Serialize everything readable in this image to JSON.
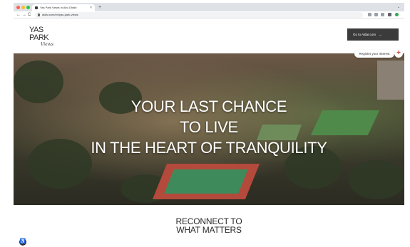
{
  "browser": {
    "tab_title": "Yas Park Views in Abu Dhabi",
    "tab_close": "×",
    "new_tab": "+",
    "tab_menu": "⌄",
    "nav": {
      "back": "←",
      "forward": "→",
      "reload": "C"
    },
    "url": "aldar.com/en/yas-park-views",
    "traffic_lights": [
      "#ff5f57",
      "#febc2e",
      "#28c840"
    ],
    "extension_icons": [
      "share-icon",
      "star-icon",
      "extensions-icon",
      "sidebar-icon",
      "profile-icon"
    ]
  },
  "header": {
    "logo": {
      "line1": "YAS",
      "line2": "PARK",
      "signature": "Views"
    },
    "cta_label": "Go to Aldar.com",
    "cta_arrow": "→"
  },
  "hero": {
    "line1": "YOUR LAST CHANCE",
    "line2": "TO LIVE",
    "line3": "IN THE HEART OF TRANQUILITY",
    "register_label": "Register your Interest",
    "plus_label": "+"
  },
  "section": {
    "line1": "RECONNECT TO",
    "line2": "WHAT MATTERS"
  },
  "accessibility": {
    "icon": "♿"
  },
  "colors": {
    "cta_bg": "#3b3b3b",
    "accent_red": "#d1443f",
    "court_green": "#3f8a5a",
    "court_red": "#b34a3c"
  }
}
